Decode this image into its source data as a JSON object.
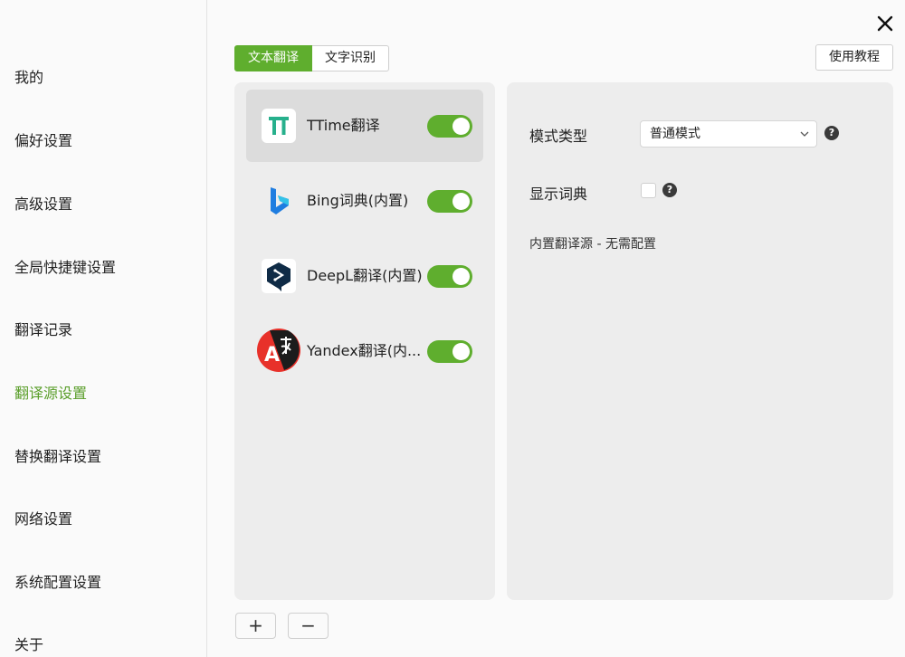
{
  "sidebar": {
    "items": [
      {
        "label": "我的"
      },
      {
        "label": "偏好设置"
      },
      {
        "label": "高级设置"
      },
      {
        "label": "全局快捷键设置"
      },
      {
        "label": "翻译记录"
      },
      {
        "label": "翻译源设置",
        "active": true
      },
      {
        "label": "替换翻译设置"
      },
      {
        "label": "网络设置"
      },
      {
        "label": "系统配置设置"
      },
      {
        "label": "关于"
      }
    ]
  },
  "tabs": [
    {
      "label": "文本翻译",
      "active": true
    },
    {
      "label": "文字识别"
    }
  ],
  "tutorial_label": "使用教程",
  "services": [
    {
      "name": "TTime翻译",
      "icon": "ttime-logo-icon",
      "enabled": true,
      "selected": true
    },
    {
      "name": "Bing词典(内置)",
      "icon": "bing-logo-icon",
      "enabled": true
    },
    {
      "name": "DeepL翻译(内置)",
      "icon": "deepl-logo-icon",
      "enabled": true
    },
    {
      "name": "Yandex翻译(内...",
      "icon": "yandex-logo-icon",
      "enabled": true
    }
  ],
  "detail": {
    "mode_label": "模式类型",
    "mode_value": "普通模式",
    "dict_label": "显示词典",
    "note": "内置翻译源 - 无需配置",
    "help_glyph": "?"
  },
  "footer": {
    "add_label": "+",
    "remove_label": "−"
  },
  "colors": {
    "accent": "#5fae2e",
    "active_nav": "#5a9e2a"
  }
}
